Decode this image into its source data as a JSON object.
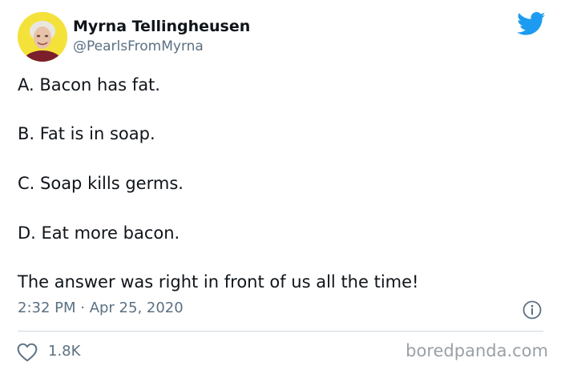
{
  "tweet": {
    "author_name": "Myrna Tellingheusen",
    "handle": "@PearlsFromMyrna",
    "lines": [
      "A.  Bacon has fat.",
      "B.  Fat is in soap.",
      "C.  Soap kills germs.",
      "D.  Eat more bacon.",
      "The answer was right in front of us all the time!"
    ],
    "timestamp": "2:32 PM · Apr 25, 2020",
    "likes": "1.8K",
    "watermark": "boredpanda.com"
  },
  "icons": {
    "platform": "twitter-bird-icon",
    "info": "info-icon",
    "like": "heart-icon"
  },
  "colors": {
    "avatar_bg": "#f4e23a",
    "brand": "#1d9bf0",
    "text": "#0f1419",
    "secondary": "#5b7083"
  }
}
